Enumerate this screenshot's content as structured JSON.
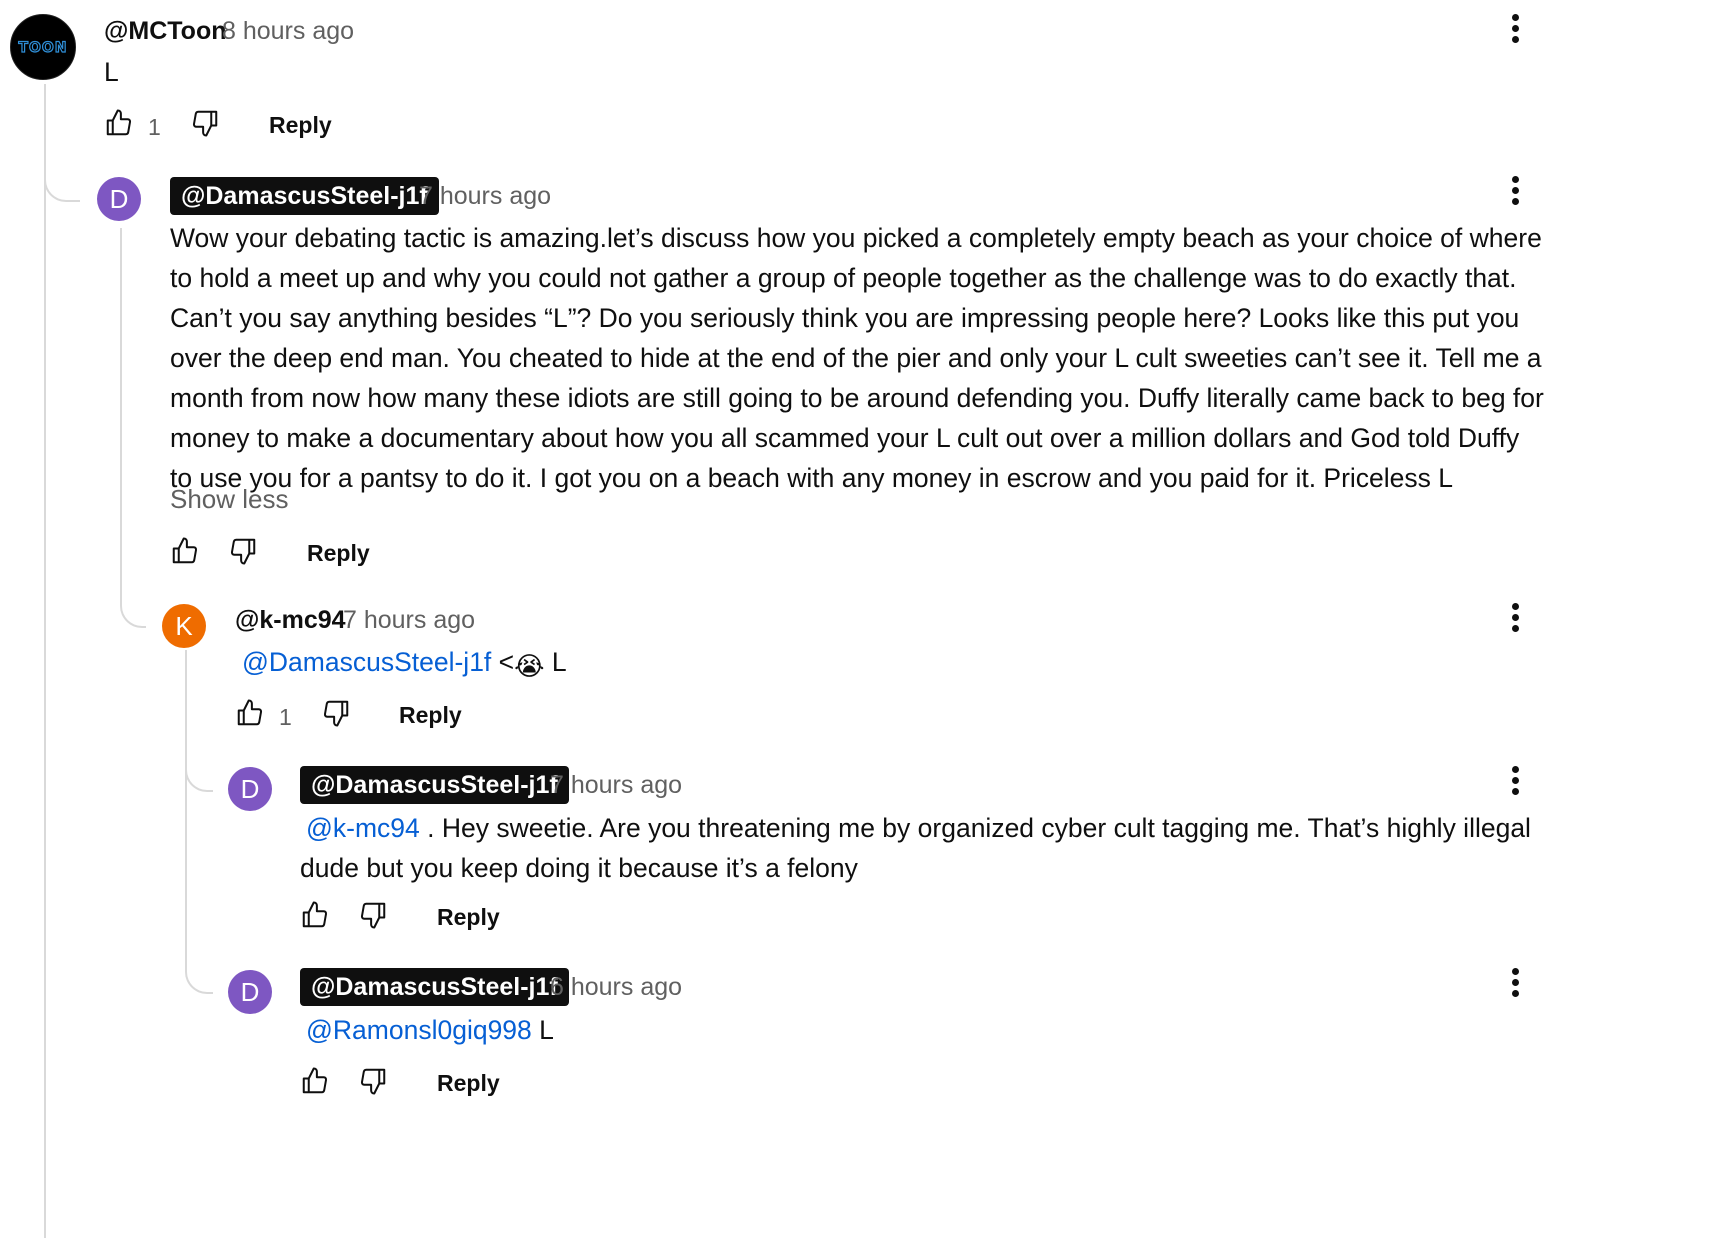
{
  "comments": [
    {
      "author": "@MCToon",
      "avatar_text": "TOON",
      "time": "8 hours ago",
      "text": "L",
      "likes": "1",
      "reply_label": "Reply"
    },
    {
      "author": "@DamascusSteel-j1f",
      "avatar_letter": "D",
      "time": "7 hours ago",
      "text": "Wow your debating tactic is  amazing.let’s discuss how you picked a completely empty beach as your choice of where to hold a meet up and why you could not gather a group of people together as the challenge was to do exactly that.  Can’t you say anything besides “L”? Do you seriously think you are impressing people here? Looks like this put you over the deep end man. You cheated to hide at the end of the pier  and only your L cult sweeties can’t see it. Tell me a month from now how many these idiots are still going to be around defending you. Duffy literally came back to beg for money to make a documentary about how you all scammed your L cult out over a million dollars and God told Duffy to use you for a pantsy to do it. I got you on a beach with any money in  escrow and you paid for it. Priceless L",
      "show_less": "Show less",
      "reply_label": "Reply"
    },
    {
      "author": "@k-mc94",
      "avatar_letter": "K",
      "time": "7 hours ago",
      "mention": "@DamascusSteel-j1f",
      "text_before_emoji": " <",
      "emoji": "😭",
      "text_after": " L",
      "likes": "1",
      "reply_label": "Reply"
    },
    {
      "author": "@DamascusSteel-j1f",
      "avatar_letter": "D",
      "time": "7 hours ago",
      "mention": "@k-mc94",
      "text": " .  Hey sweetie. Are you threatening me by organized cyber cult tagging me. That’s highly illegal  dude but you keep doing it because it’s a felony",
      "reply_label": "Reply"
    },
    {
      "author": "@DamascusSteel-j1f",
      "avatar_letter": "D",
      "time": "6 hours ago",
      "mention": "@Ramonsl0giq998",
      "text": " L",
      "reply_label": "Reply"
    }
  ],
  "icons": {
    "like": "thumb-up-icon",
    "dislike": "thumb-down-icon",
    "menu": "more-vert-icon"
  }
}
